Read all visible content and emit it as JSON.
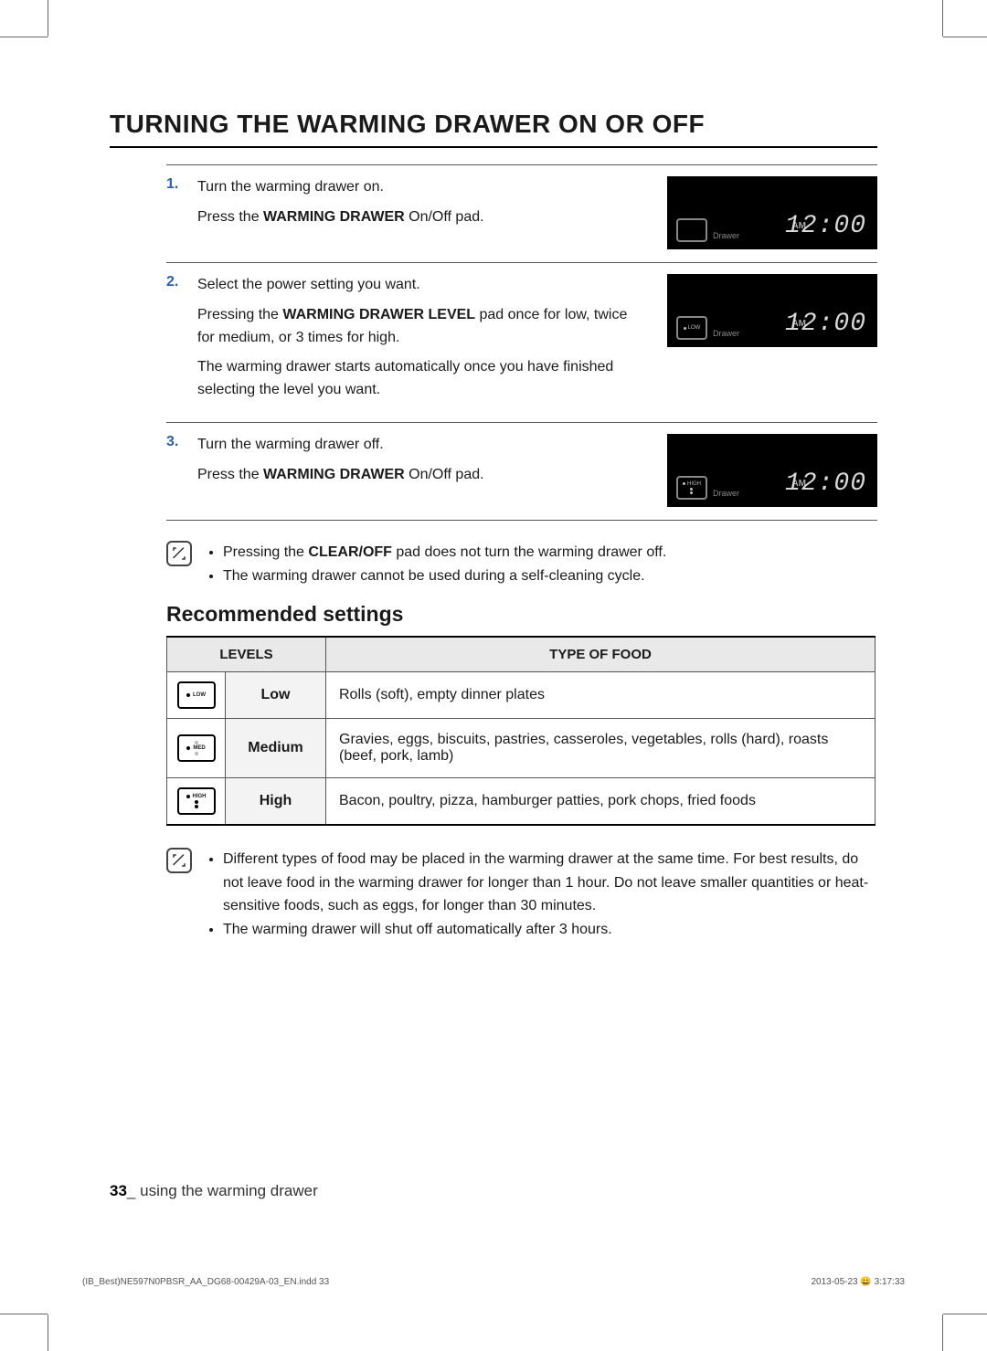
{
  "title": "TURNING THE WARMING DRAWER ON OR OFF",
  "steps": [
    {
      "num": "1",
      "lines": [
        {
          "t": "Turn the warming drawer on."
        },
        {
          "t_parts": [
            "Press the ",
            {
              "b": "WARMING DRAWER"
            },
            " On/Off pad."
          ]
        }
      ],
      "display": {
        "level": null
      }
    },
    {
      "num": "2",
      "lines": [
        {
          "t": "Select the power setting you want."
        },
        {
          "t_parts": [
            "Pressing the ",
            {
              "b": "WARMING DRAWER LEVEL"
            },
            " pad once for low, twice for medium, or 3 times for high."
          ]
        },
        {
          "t": "The warming drawer starts automatically once you have finished selecting the level you want."
        }
      ],
      "display": {
        "level": "LOW"
      }
    },
    {
      "num": "3",
      "lines": [
        {
          "t": "Turn the warming drawer off."
        },
        {
          "t_parts": [
            "Press the ",
            {
              "b": "WARMING DRAWER"
            },
            " On/Off pad."
          ]
        }
      ],
      "display": {
        "level": "HIGH"
      }
    }
  ],
  "display_common": {
    "drawer": "Drawer",
    "am": "AM",
    "clock": "12:00"
  },
  "notes1": [
    {
      "parts": [
        "Pressing the ",
        {
          "b": "CLEAR/OFF"
        },
        " pad does not turn the warming drawer off."
      ]
    },
    {
      "parts": [
        "The warming drawer cannot be used during a self-cleaning cycle."
      ]
    }
  ],
  "subtitle": "Recommended settings",
  "table": {
    "head": [
      "LEVELS",
      "TYPE OF FOOD"
    ],
    "rows": [
      {
        "level_label": "Low",
        "icon_label": "LOW",
        "food": "Rolls (soft), empty dinner plates"
      },
      {
        "level_label": "Medium",
        "icon_label": "MED",
        "food": "Gravies, eggs, biscuits, pastries, casseroles, vegetables, rolls (hard), roasts (beef, pork, lamb)"
      },
      {
        "level_label": "High",
        "icon_label": "HIGH",
        "food": "Bacon, poultry, pizza, hamburger patties, pork chops, fried foods"
      }
    ]
  },
  "notes2": [
    {
      "parts": [
        "Different types of food may be placed in the warming drawer at the same time. For best results, do not leave food in the warming drawer for longer than 1 hour. Do not leave smaller quantities or heat-sensitive foods, such as eggs, for longer than 30 minutes."
      ]
    },
    {
      "parts": [
        "The warming drawer will shut off automatically after 3 hours."
      ]
    }
  ],
  "footer": {
    "page_num": "33",
    "section": "using the warming drawer",
    "sep": "_ "
  },
  "print": {
    "left": "(IB_Best)NE597N0PBSR_AA_DG68-00429A-03_EN.indd   33",
    "right": "2013-05-23   😀 3:17:33"
  }
}
